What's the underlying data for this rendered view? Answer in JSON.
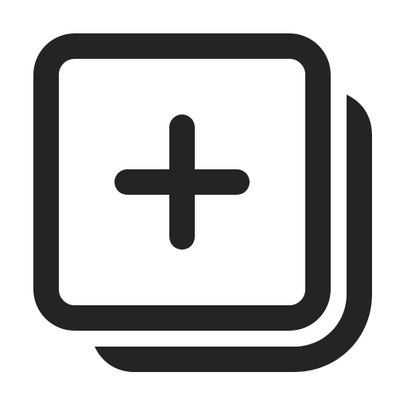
{
  "icon": {
    "name": "add-collection-icon",
    "color": "#242424",
    "background": "#ffffff"
  }
}
